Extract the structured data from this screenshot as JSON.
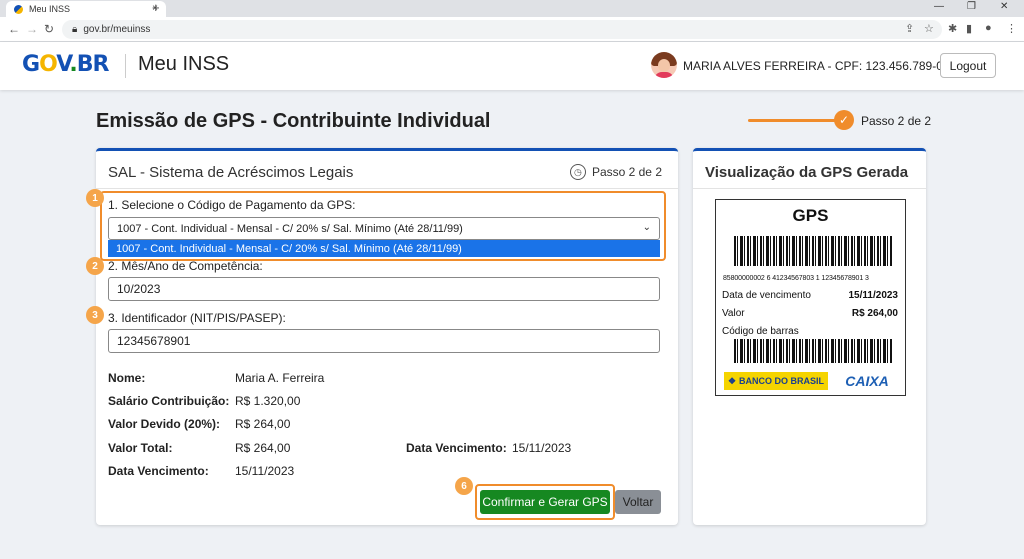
{
  "browser": {
    "tab_title": "Meu INSS",
    "url": "gov.br/meuinss"
  },
  "header": {
    "logo_parts": [
      "G",
      "O",
      "V",
      ".",
      "BR"
    ],
    "app_title": "Meu INSS",
    "user": "MARIA ALVES FERREIRA - CPF: 123.456.789-00",
    "logout_label": "Logout"
  },
  "page": {
    "title": "Emissão de GPS - Contribuinte Individual",
    "step_label": "Passo 2 de 2"
  },
  "form_card": {
    "title": "SAL - Sistema de Acréscimos Legais",
    "step_label": "Passo 2 de 2",
    "fields": [
      {
        "badge": "1",
        "label": "1. Selecione o Código de Pagamento da GPS:",
        "value": "1007 - Cont. Individual - Mensal - C/ 20% s/ Sal. Mínimo (Até 28/11/99)"
      },
      {
        "badge": "2",
        "label": "2. Mês/Ano de Competência:",
        "value": "10/2023"
      },
      {
        "badge": "3",
        "label": "3. Identificador (NIT/PIS/PASEP):",
        "value": "12345678901"
      }
    ],
    "dropdown_option": "1007 - Cont. Individual - Mensal - C/ 20% s/ Sal. Mínimo (Até 28/11/99)",
    "summary": {
      "nome_label": "Nome:",
      "nome_value": "Maria A. Ferreira",
      "salario_label": "Salário Contribuição:",
      "salario_value": "R$ 1.320,00",
      "devido_label": "Valor Devido (20%):",
      "devido_value": "R$ 264,00",
      "total_label": "Valor Total:",
      "total_value": "R$ 264,00",
      "venc_label": "Data Vencimento:",
      "venc_value": "15/11/2023",
      "venc2_label": "Data Vencimento:",
      "venc2_value": "15/11/2023"
    },
    "confirm_badge": "6",
    "confirm_label": "Confirmar e Gerar GPS",
    "back_label": "Voltar"
  },
  "preview_card": {
    "title": "Visualização da GPS Gerada",
    "ticket_title": "GPS",
    "barcode_number": "85800000002 6 41234567803 1 12345678901 3",
    "rows": [
      {
        "label": "Data de vencimento",
        "value": "15/11/2023"
      },
      {
        "label": "Valor",
        "value": "R$ 264,00"
      }
    ],
    "barcode_label": "Código de barras",
    "bank1": "BANCO DO BRASIL",
    "bank2": "CAIXA"
  },
  "colors": {
    "gov_blue": "#1351b4",
    "gov_yellow": "#f5b500",
    "accent_orange": "#f08c2b",
    "confirm_green": "#168821",
    "dropdown_blue": "#1a73e8"
  }
}
